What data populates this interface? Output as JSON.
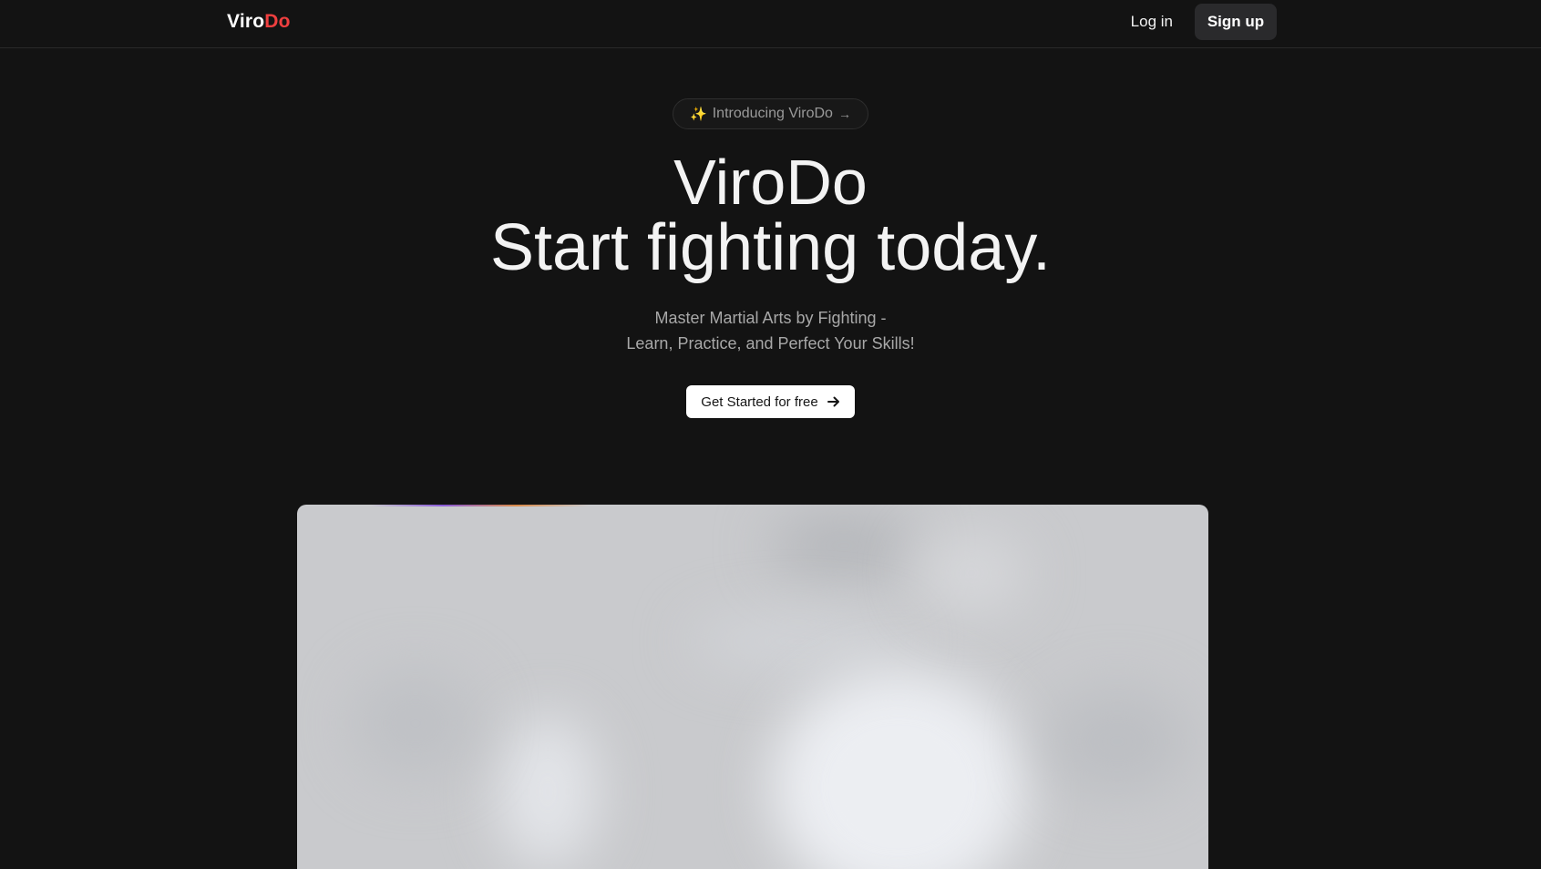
{
  "navbar": {
    "brand_part1": "Viro",
    "brand_part2": "Do",
    "login_label": "Log in",
    "signup_label": "Sign up"
  },
  "hero": {
    "pill_icon": "sparkles-icon",
    "pill_text": "Introducing ViroDo",
    "pill_arrow": "→",
    "title_line1": "ViroDo",
    "title_line2": "Start fighting today.",
    "subtitle_line1": "Master Martial Arts by Fighting -",
    "subtitle_line2": "Learn, Practice, and Perfect Your Skills!",
    "cta_label": "Get Started for free",
    "cta_icon": "arrow-right-icon"
  },
  "colors": {
    "background": "#131313",
    "brand_accent": "#ef3f3f",
    "cta_bg": "#ffffff",
    "signup_bg": "#2a2a2c"
  }
}
